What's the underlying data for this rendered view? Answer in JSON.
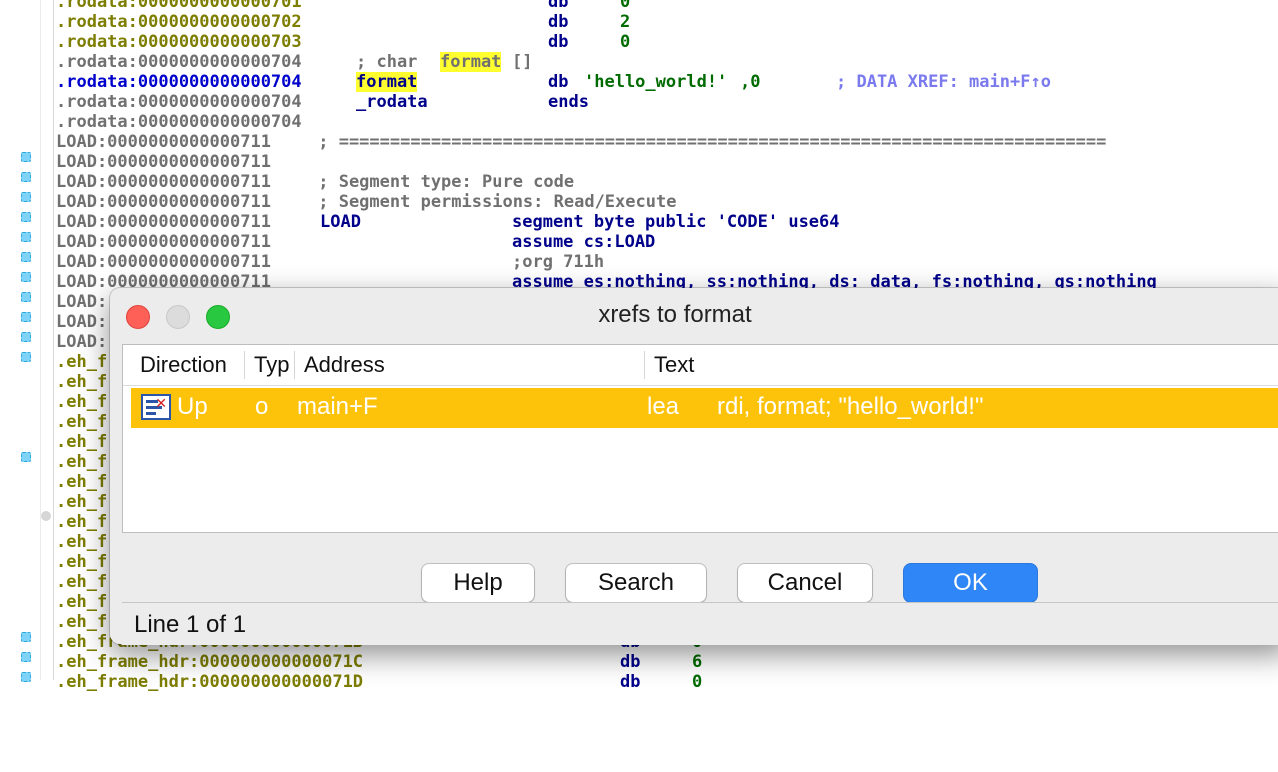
{
  "listing": {
    "lines": [
      {
        "addr": ".rodata:0000000000000701",
        "rest": "",
        "mnem": "db",
        "op": "0"
      },
      {
        "addr": ".rodata:0000000000000702",
        "rest": "",
        "mnem": "db",
        "op": "2"
      },
      {
        "addr": ".rodata:0000000000000703",
        "rest": "",
        "mnem": "db",
        "op": "0"
      },
      {
        "addr": ".rodata:0000000000000704",
        "c1": "; char ",
        "c2": "format",
        "c3": "[]"
      },
      {
        "addr": ".rodata:0000000000000704",
        "name": "format",
        "mnem": "db",
        "op1": "'hello_world!'",
        "op2": ",0",
        "xref": "; DATA XREF: main+F↑o"
      },
      {
        "addr": ".rodata:0000000000000704",
        "name": "_rodata",
        "mnem": "ends"
      },
      {
        "addr": ".rodata:0000000000000704"
      },
      {
        "addr": "LOAD:0000000000000711",
        "rest": " ; ==========================================================================="
      },
      {
        "addr": "LOAD:0000000000000711"
      },
      {
        "addr": "LOAD:0000000000000711",
        "rest": " ; Segment type: Pure code"
      },
      {
        "addr": "LOAD:0000000000000711",
        "rest": " ; Segment permissions: Read/Execute"
      },
      {
        "addr": "LOAD:0000000000000711",
        "name": "LOAD",
        "op": "segment byte public 'CODE' use64"
      },
      {
        "addr": "LOAD:0000000000000711",
        "op": "assume cs:LOAD"
      },
      {
        "addr": "LOAD:0000000000000711",
        "op": ";org 711h"
      },
      {
        "addr": "LOAD:0000000000000711",
        "op": "assume es:nothing, ss:nothing, ds:_data, fs:nothing, gs:nothing"
      }
    ],
    "partial_labels": [
      "LOAD:",
      "LOAD:",
      "LOAD:",
      ".eh_f",
      ".eh_f",
      ".eh_f",
      ".eh_f",
      ".eh_f",
      ".eh_f",
      ".eh_f",
      ".eh_f",
      ".eh_f",
      ".eh_f",
      ".eh_f",
      ".eh_f",
      ".eh_f",
      ".eh_f"
    ],
    "bottom_lines": [
      {
        "addr": ".eh_frame_hdr:000000000000071B",
        "mnem": "db",
        "op": "0"
      },
      {
        "addr": ".eh_frame_hdr:000000000000071C",
        "mnem": "db",
        "op": "6"
      },
      {
        "addr": ".eh_frame_hdr:000000000000071D",
        "mnem": "db",
        "op": "0"
      }
    ]
  },
  "dialog": {
    "title": "xrefs to format",
    "columns": [
      "Direction",
      "Typ",
      "Address",
      "Text"
    ],
    "rows": [
      {
        "direction": "Up",
        "type": "o",
        "address": "main+F",
        "text_mnem": "lea",
        "text_ops": "rdi, format; \"hello_world!\""
      }
    ],
    "buttons": {
      "help": "Help",
      "search": "Search",
      "cancel": "Cancel",
      "ok": "OK"
    },
    "status": "Line 1 of 1"
  },
  "colors": {
    "selection": "#fdc20a",
    "ok_button": "#2f86f6",
    "highlight": "#ffff30",
    "traffic_close": "#fe5f57",
    "traffic_max": "#28c840"
  }
}
